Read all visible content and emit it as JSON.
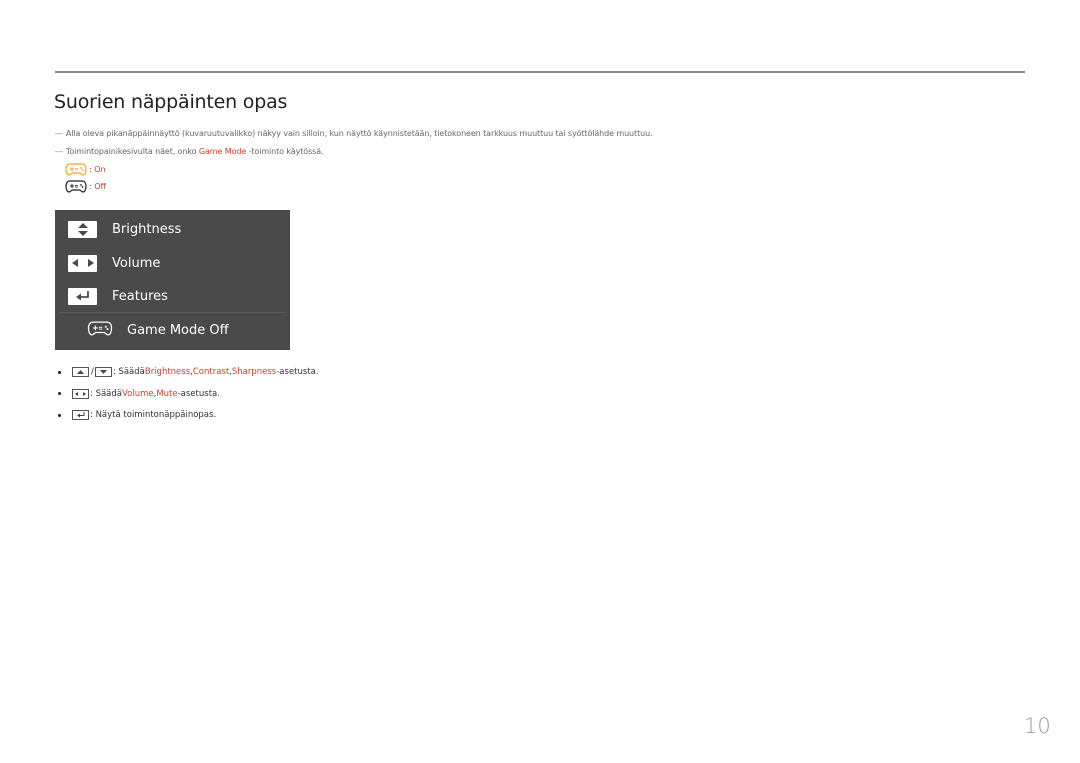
{
  "page": {
    "title": "Suorien näppäinten opas",
    "page_number": "10"
  },
  "notes": [
    {
      "text": "Alla oleva pikanäppäinnäyttö (kuvaruutuvalikko) näkyy vain silloin, kun näyttö käynnistetään, tietokoneen tarkkuus muuttuu tai syöttölähde muuttuu."
    },
    {
      "prefix": "Toimintopainikesivulta näet, onko ",
      "highlight": "Game Mode",
      "suffix": " -toiminto käytössä."
    }
  ],
  "legend": [
    {
      "icon": "gamepad-on-icon",
      "label": ": On",
      "color": "#f5a623"
    },
    {
      "icon": "gamepad-off-icon",
      "label": ": Off",
      "color": "#222222"
    }
  ],
  "osd": {
    "items": [
      {
        "icon": "up-down-arrows-icon",
        "label": "Brightness"
      },
      {
        "icon": "left-right-arrows-icon",
        "label": "Volume"
      },
      {
        "icon": "enter-icon",
        "label": "Features"
      }
    ],
    "game_mode": {
      "icon": "gamepad-icon",
      "label": "Game Mode Off"
    }
  },
  "bullets": [
    {
      "sep": ": Säädä ",
      "links": [
        "Brightness",
        "Contrast",
        "Sharpness"
      ],
      "suffix": "-asetusta."
    },
    {
      "sep": ": Säädä ",
      "links": [
        "Volume",
        "Mute"
      ],
      "suffix": "-asetusta."
    },
    {
      "sep": ": Näytä toimintonäppäinopas.",
      "links": [],
      "suffix": ""
    }
  ],
  "punct": {
    "comma": ", ",
    "slash": "/",
    "dash": "―"
  },
  "colors": {
    "accent": "#c8412c",
    "osd_bg": "#4a4a4a",
    "gamepad_on": "#f5a623"
  }
}
